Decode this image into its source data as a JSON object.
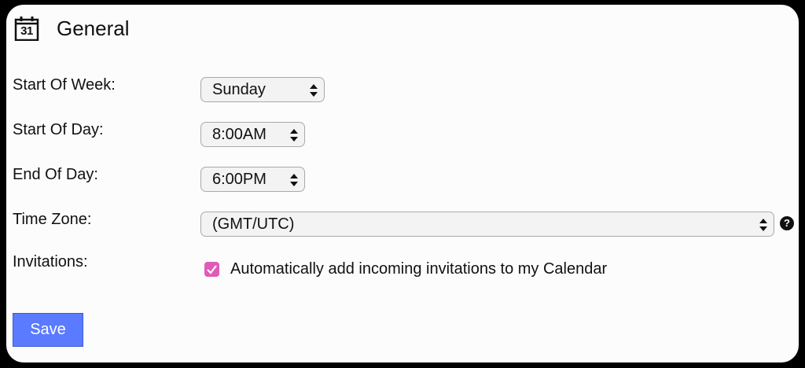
{
  "header": {
    "icon": "calendar-icon",
    "icon_day": "31",
    "title": "General"
  },
  "settings": {
    "start_of_week": {
      "label": "Start Of Week:",
      "value": "Sunday"
    },
    "start_of_day": {
      "label": "Start Of Day:",
      "value": "8:00AM"
    },
    "end_of_day": {
      "label": "End Of Day:",
      "value": "6:00PM"
    },
    "time_zone": {
      "label": "Time Zone:",
      "value": "(GMT/UTC)",
      "help_icon": "question-icon",
      "help_glyph": "?"
    },
    "invitations": {
      "label": "Invitations:",
      "checkbox_checked": true,
      "checkbox_label": "Automatically add incoming invitations to my Calendar"
    }
  },
  "actions": {
    "save_label": "Save"
  },
  "colors": {
    "checkbox": "#e05bb8",
    "save_button": "#5a7bff",
    "frame": "#000000",
    "panel": "#fcfcfc"
  }
}
